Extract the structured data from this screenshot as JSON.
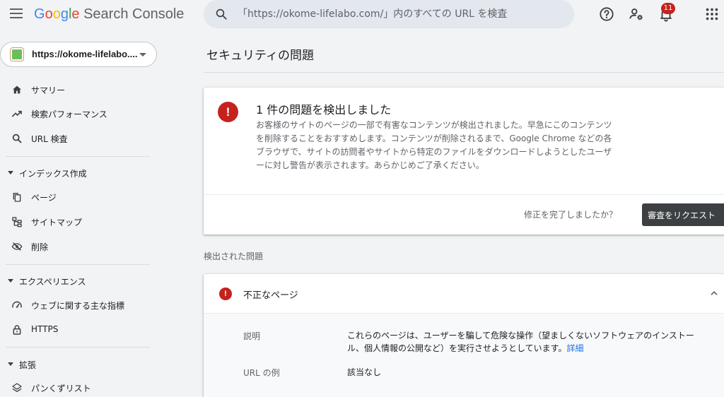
{
  "header": {
    "logo_google": [
      "G",
      "o",
      "o",
      "g",
      "l",
      "e"
    ],
    "logo_product": "Search Console",
    "search_placeholder": "「https://okome-lifelabo.com/」内のすべての URL を検査",
    "notification_count": "11"
  },
  "sidebar": {
    "property_label": "https://okome-lifelabo....",
    "items": [
      {
        "label": "サマリー",
        "icon": "home-icon"
      },
      {
        "label": "検索パフォーマンス",
        "icon": "trending-up-icon"
      },
      {
        "label": "URL 検査",
        "icon": "search-icon"
      }
    ],
    "sections": [
      {
        "label": "インデックス作成",
        "items": [
          {
            "label": "ページ",
            "icon": "pages-icon"
          },
          {
            "label": "サイトマップ",
            "icon": "sitemap-icon"
          },
          {
            "label": "削除",
            "icon": "removal-icon"
          }
        ]
      },
      {
        "label": "エクスペリエンス",
        "items": [
          {
            "label": "ウェブに関する主な指標",
            "icon": "speedometer-icon"
          },
          {
            "label": "HTTPS",
            "icon": "lock-icon"
          }
        ]
      },
      {
        "label": "拡張",
        "items": [
          {
            "label": "パンくずリスト",
            "icon": "layers-icon"
          }
        ]
      }
    ]
  },
  "main": {
    "page_title": "セキュリティの問題",
    "issue_card": {
      "icon_glyph": "!",
      "heading": "1 件の問題を検出しました",
      "description": "お客様のサイトのページの一部で有害なコンテンツが検出されました。早急にこのコンテンツを削除することをおすすめします。コンテンツが削除されるまで、Google Chrome などの各ブラウザで、サイトの訪問者やサイトから特定のファイルをダウンロードしようとしたユーザーに対し警告が表示されます。あらかじめご了承ください。",
      "fixed_question": "修正を完了しましたか？",
      "review_button": "審査をリクエスト"
    },
    "detected_label": "検出された問題",
    "detail_card": {
      "icon_glyph": "!",
      "title": "不正なページ",
      "description_label": "説明",
      "description_text": "これらのページは、ユーザーを騙して危険な操作（望ましくないソフトウェアのインストール、個人情報の公開など）を実行させようとしています。",
      "details_link": "詳細",
      "url_example_label": "URL の例",
      "url_example_value": "該当なし"
    }
  },
  "colors": {
    "error_red": "#c5221f",
    "link_blue": "#1a73e8",
    "button_dark": "#3c4043",
    "background": "#f1f3f4"
  }
}
